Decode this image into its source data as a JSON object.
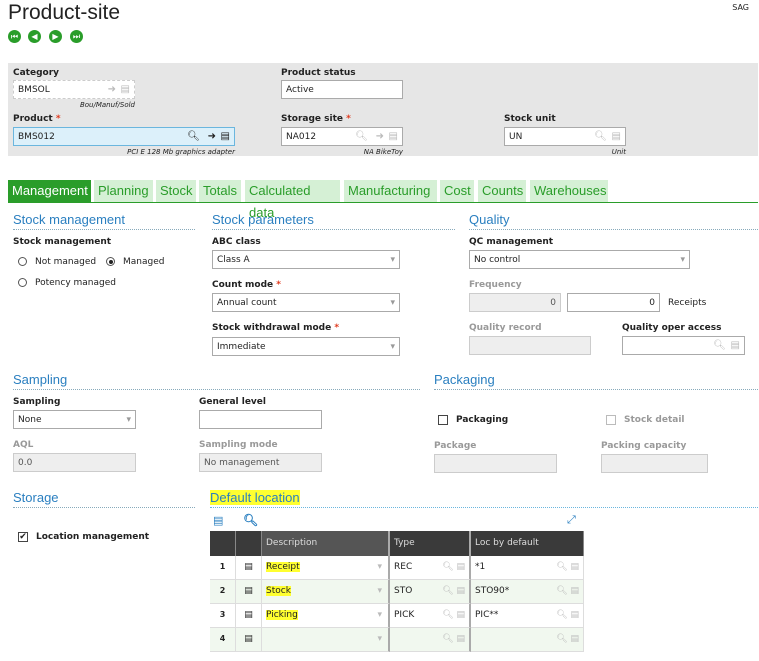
{
  "header": {
    "title": "Product-site",
    "user": "SAG"
  },
  "nav": [
    "first-icon",
    "previous-icon",
    "next-icon",
    "last-icon"
  ],
  "fields": {
    "category": {
      "label": "Category",
      "value": "BMSOL",
      "caption": "Bou/Manuf/Sold"
    },
    "product_status": {
      "label": "Product status",
      "value": "Active"
    },
    "product": {
      "label": "Product",
      "value": "BMS012",
      "caption": "PCI E 128 Mb graphics adapter"
    },
    "storage_site": {
      "label": "Storage site",
      "value": "NA012",
      "caption": "NA BikeToy"
    },
    "stock_unit": {
      "label": "Stock unit",
      "value": "UN",
      "caption": "Unit"
    },
    "required": "*"
  },
  "tabs": [
    "Management",
    "Planning",
    "Stock",
    "Totals",
    "Calculated data",
    "Manufacturing",
    "Cost",
    "Counts",
    "Warehouses"
  ],
  "stock_management": {
    "heading": "Stock management",
    "label": "Stock management",
    "options": [
      "Not managed",
      "Managed",
      "Potency managed"
    ],
    "selected": "Managed"
  },
  "stock_parameters": {
    "heading": "Stock parameters",
    "abc_label": "ABC class",
    "abc_value": "Class A",
    "count_label": "Count mode",
    "count_value": "Annual count",
    "withdrawal_label": "Stock withdrawal mode",
    "withdrawal_value": "Immediate"
  },
  "quality": {
    "heading": "Quality",
    "qc_label": "QC management",
    "qc_value": "No control",
    "freq_label": "Frequency",
    "freq_value1": "0",
    "freq_value2": "0",
    "receipts": "Receipts",
    "record_label": "Quality record",
    "oper_label": "Quality oper access"
  },
  "sampling": {
    "heading": "Sampling",
    "label": "Sampling",
    "value": "None",
    "general_label": "General level",
    "aql_label": "AQL",
    "aql_value": "0.0",
    "mode_label": "Sampling mode",
    "mode_value": "No management"
  },
  "packaging": {
    "heading": "Packaging",
    "packaging_label": "Packaging",
    "stock_detail_label": "Stock detail",
    "package_label": "Package",
    "capacity_label": "Packing capacity"
  },
  "storage": {
    "heading": "Storage",
    "location_management": "Location management",
    "checked": true
  },
  "default_location": {
    "heading": "Default location",
    "columns": [
      "Description",
      "Type",
      "Loc by default"
    ],
    "rows": [
      {
        "n": "1",
        "desc": "Receipt",
        "type": "REC",
        "loc": "*1"
      },
      {
        "n": "2",
        "desc": "Stock",
        "type": "STO",
        "loc": "STO90*"
      },
      {
        "n": "3",
        "desc": "Picking",
        "type": "PICK",
        "loc": "PIC**"
      },
      {
        "n": "4",
        "desc": "",
        "type": "",
        "loc": ""
      }
    ]
  },
  "colors": {
    "accent": "#2a9d2a",
    "heading": "#2a7fc0",
    "highlight": "#ffff30"
  }
}
